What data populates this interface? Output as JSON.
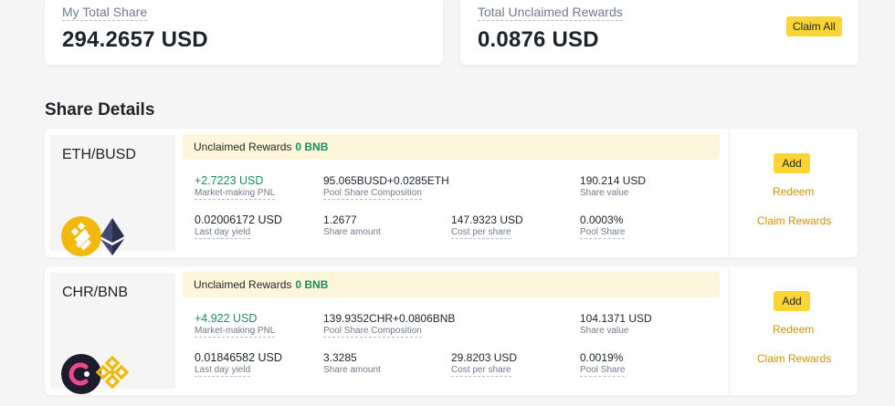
{
  "summary": {
    "total_share_label": "My Total Share",
    "total_share_value": "294.2657 USD",
    "unclaimed_label": "Total Unclaimed Rewards",
    "unclaimed_value": "0.0876 USD",
    "claim_all_label": "Claim All"
  },
  "section_title": "Share Details",
  "pools": [
    {
      "name": "ETH/BUSD",
      "tokens": [
        "busd-icon",
        "eth-icon"
      ],
      "unclaimed_label": "Unclaimed Rewards",
      "unclaimed_value": "0 BNB",
      "pnl_value": "+2.7223 USD",
      "pnl_label": "Market-making PNL",
      "composition_value": "95.065BUSD+0.0285ETH",
      "composition_label": "Pool Share Composition",
      "share_value": "190.214 USD",
      "share_value_label": "Share value",
      "yield_value": "0.02006172 USD",
      "yield_label": "Last day yield",
      "amount_value": "1.2677",
      "amount_label": "Share amount",
      "cost_value": "147.9323 USD",
      "cost_label": "Cost per share",
      "pool_share_value": "0.0003%",
      "pool_share_label": "Pool Share",
      "add_label": "Add",
      "redeem_label": "Redeem",
      "claim_label": "Claim Rewards"
    },
    {
      "name": "CHR/BNB",
      "tokens": [
        "chr-icon",
        "bnb-icon"
      ],
      "unclaimed_label": "Unclaimed Rewards",
      "unclaimed_value": "0 BNB",
      "pnl_value": "+4.922 USD",
      "pnl_label": "Market-making PNL",
      "composition_value": "139.9352CHR+0.0806BNB",
      "composition_label": "Pool Share Composition",
      "share_value": "104.1371 USD",
      "share_value_label": "Share value",
      "yield_value": "0.01846582 USD",
      "yield_label": "Last day yield",
      "amount_value": "3.3285",
      "amount_label": "Share amount",
      "cost_value": "29.8203 USD",
      "cost_label": "Cost per share",
      "pool_share_value": "0.0019%",
      "pool_share_label": "Pool Share",
      "add_label": "Add",
      "redeem_label": "Redeem",
      "claim_label": "Claim Rewards"
    }
  ],
  "colors": {
    "accent": "#fcd535",
    "positive": "#1f8a5b",
    "link": "#c99400",
    "banner": "#fef6d8"
  }
}
